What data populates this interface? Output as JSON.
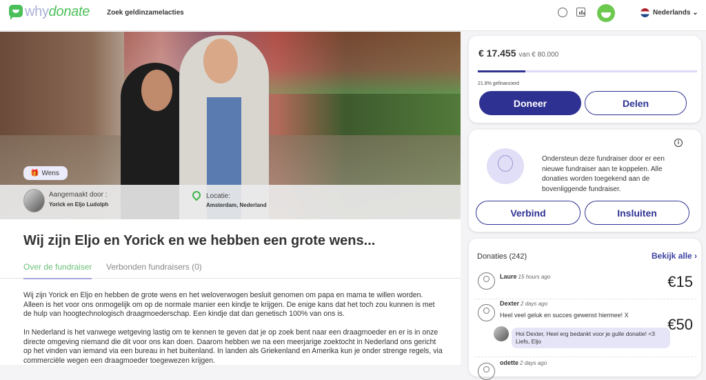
{
  "header": {
    "logo_why": "why",
    "logo_donate": "donate",
    "search_link": "Zoek geldinzamelacties",
    "language": "Nederlands",
    "icons": [
      "palette-icon",
      "chart-icon",
      "avatar",
      "flag-nl-icon",
      "chevron-down-icon"
    ]
  },
  "fundraiser": {
    "category_tag": "Wens",
    "creator_label": "Aangemaakt door :",
    "creator_name": "Yorick en Eljo Ludolph",
    "location_label": "Locatie:",
    "location_value": "Amsterdam, Nederland",
    "title": "Wij zijn Eljo en Yorick en we hebben een grote wens...",
    "tabs": [
      {
        "label": "Over de fundraiser",
        "active": true
      },
      {
        "label": "Verbonden fundraisers (0)",
        "active": false
      }
    ],
    "paragraphs": [
      "Wij zijn Yorick en Eljo en hebben de grote wens en het weloverwogen besluit genomen om papa en mama te willen worden. Alleen is het voor ons onmogelijk om op de normale manier een kindje te krijgen. De enige kans dat het toch zou kunnen is met de hulp van hoogtechnologisch draagmoederschap. Een kindje dat dan genetisch 100% van ons is.",
      "In Nederland is het vanwege wetgeving lastig om te kennen te geven dat je op zoek bent naar een draagmoeder en er is in onze directe omgeving niemand die dit voor ons kan doen. Daarom hebben we na een meerjarige zoektocht in Nederland ons gericht op het vinden van iemand via een bureau in het buitenland. In landen als Griekenland en Amerika kun je onder strenge regels, via commerciële wegen een draagmoeder toegewezen krijgen."
    ]
  },
  "progress": {
    "raised": "€ 17.455",
    "goal": "van € 80.000",
    "percent_label": "21.8% gefinancierd",
    "percent": 21.8,
    "donate_label": "Doneer",
    "share_label": "Delen",
    "accent": "#2e3192"
  },
  "connect": {
    "text": "Ondersteun deze fundraiser door er een nieuwe fundraiser aan te koppelen. Alle donaties worden toegekend aan de bovenliggende fundraiser.",
    "connect_label": "Verbind",
    "embed_label": "Insluiten",
    "info": "i"
  },
  "donations": {
    "title": "Donaties (242)",
    "see_all": "Bekijk alle ›",
    "items": [
      {
        "name": "Laure",
        "time": "15 hours ago",
        "amount": "€15"
      },
      {
        "name": "Dexter",
        "time": "2 days ago",
        "amount": "€50",
        "message": "Heel veel geluk en succes gewenst hiermee! X",
        "reply": "Hoi Dexter, Heel erg bedankt voor je gulle donatie! <3 Liefs, Eljo"
      },
      {
        "name": "odette",
        "time": "2 days ago"
      }
    ]
  }
}
